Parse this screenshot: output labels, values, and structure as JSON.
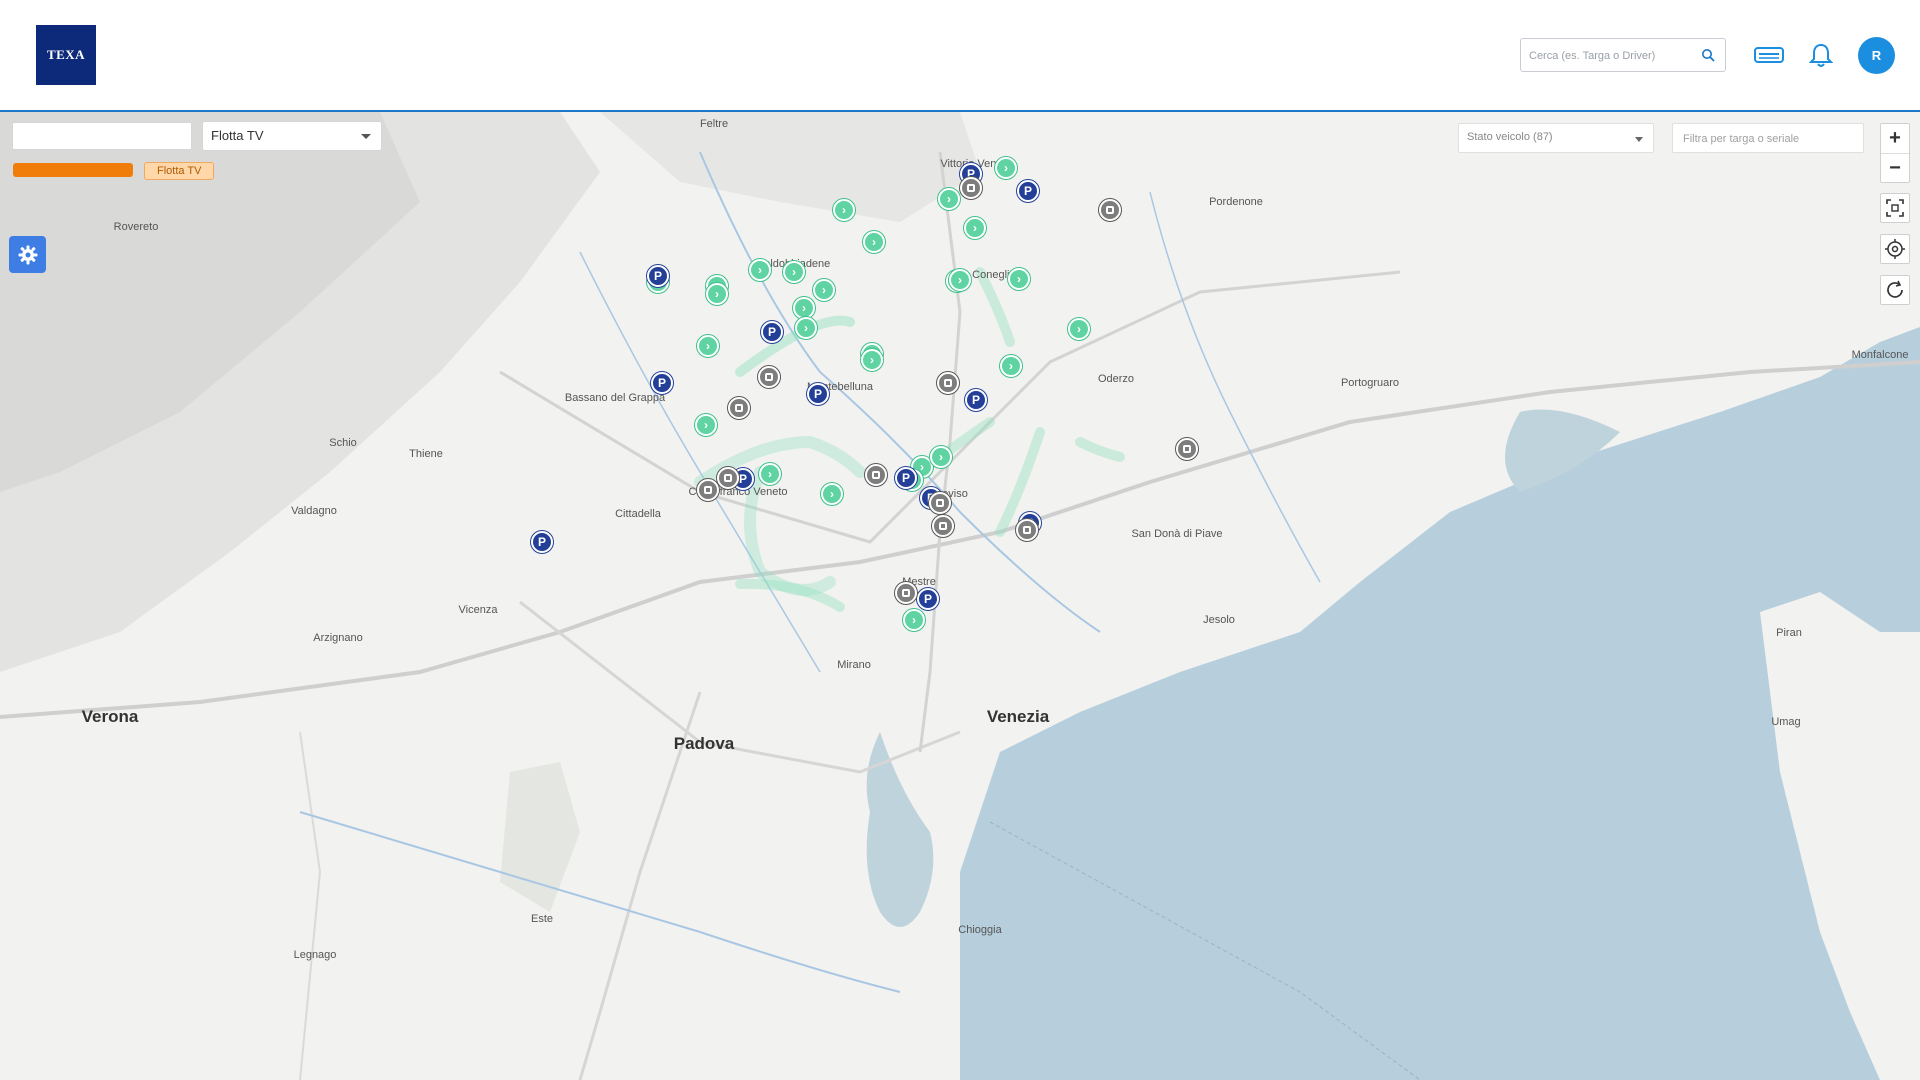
{
  "header": {
    "logo_text": "TEXA",
    "search_placeholder": "Cerca (es. Targa o Driver)",
    "avatar_initial": "R"
  },
  "controls": {
    "fleet_select_value": "Flotta TV",
    "fleet_chip_label": "Flotta TV",
    "status_select_value": "Stato veicolo (87)",
    "plate_filter_placeholder": "Filtra per targa o seriale",
    "zoom_in": "+",
    "zoom_out": "−"
  },
  "colors": {
    "accent": "#1a77c9",
    "logo_bg": "#0d2a7a",
    "fleet_bar": "#f07d0a",
    "marker_moving": "#5fd3a2",
    "marker_parked": "#233f98",
    "marker_off": "#7d7d7d",
    "sea": "#b7cfdc"
  },
  "map": {
    "cities": [
      {
        "name": "Venezia",
        "big": true
      },
      {
        "name": "Padova",
        "big": true
      },
      {
        "name": "Verona",
        "big": true
      },
      {
        "name": "Vicenza",
        "big": false
      },
      {
        "name": "Treviso",
        "big": false
      },
      {
        "name": "Bassano del Grappa",
        "big": false
      },
      {
        "name": "Montebelluna",
        "big": false
      },
      {
        "name": "Conegliano",
        "big": false
      },
      {
        "name": "Pordenone",
        "big": false
      },
      {
        "name": "San Donà di Piave",
        "big": false
      },
      {
        "name": "Portogruaro",
        "big": false
      },
      {
        "name": "Jesolo",
        "big": false
      },
      {
        "name": "Chioggia",
        "big": false
      },
      {
        "name": "Rovereto",
        "big": false
      },
      {
        "name": "Feltre",
        "big": false
      },
      {
        "name": "Schio",
        "big": false
      },
      {
        "name": "Thiene",
        "big": false
      },
      {
        "name": "Castelfranco Veneto",
        "big": false
      },
      {
        "name": "Mestre",
        "big": false
      },
      {
        "name": "Monfalcone",
        "big": false
      },
      {
        "name": "Legnago",
        "big": false
      },
      {
        "name": "Este",
        "big": false
      },
      {
        "name": "Piran",
        "big": false
      },
      {
        "name": "Umag",
        "big": false
      },
      {
        "name": "Oderzo",
        "big": false
      },
      {
        "name": "Valdobbiadene",
        "big": false
      },
      {
        "name": "Mirano",
        "big": false
      },
      {
        "name": "Cittadella",
        "big": false
      },
      {
        "name": "Arzignano",
        "big": false
      },
      {
        "name": "Valdagno",
        "big": false
      },
      {
        "name": "Vittorio Veneto",
        "big": false
      }
    ],
    "markers": [
      {
        "type": "green",
        "symbol": "›"
      },
      {
        "type": "parked",
        "symbol": "P"
      },
      {
        "type": "grey",
        "symbol": ""
      }
    ]
  }
}
